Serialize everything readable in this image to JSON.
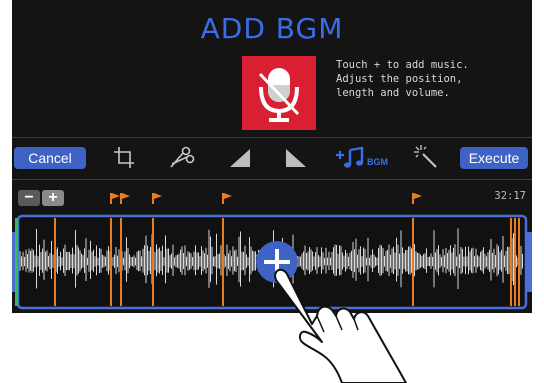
{
  "header": {
    "title": "ADD BGM"
  },
  "hint": {
    "lines": [
      "Touch + to add music.",
      "Adjust the position,",
      "length and volume."
    ]
  },
  "toolbar": {
    "cancel_label": "Cancel",
    "execute_label": "Execute",
    "bgm_label": "BGM",
    "tools": [
      "crop-icon",
      "scissors-icon",
      "fade-in-icon",
      "fade-out-icon",
      "add-bgm-icon",
      "magic-wand-icon"
    ]
  },
  "timeline": {
    "zoom_out_label": "−",
    "zoom_in_label": "+",
    "duration": "32:17"
  },
  "colors": {
    "accent": "#3a6ee8",
    "button": "#3e63c4",
    "mic_box": "#d91f32",
    "marker": "#e87d1e",
    "timeline_border": "#4a6fd6",
    "playhead": "#2fbf4a"
  }
}
